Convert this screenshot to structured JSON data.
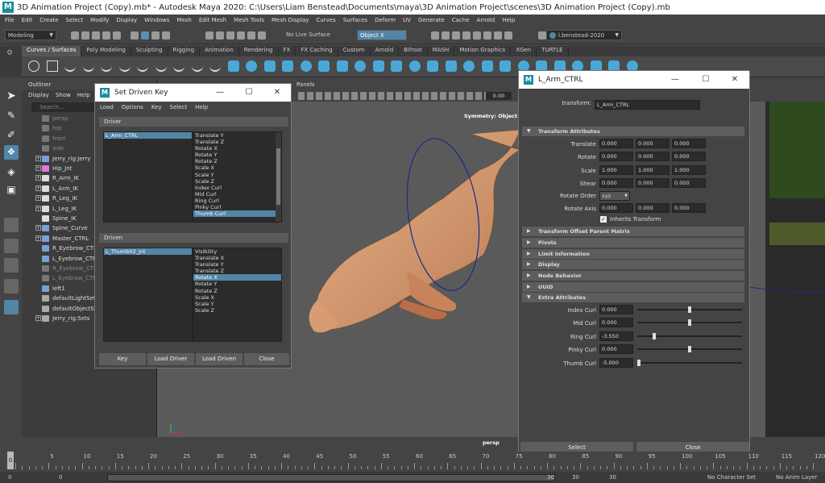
{
  "window": {
    "title": "3D Animation Project (Copy).mb* - Autodesk Maya 2020: C:\\Users\\Liam Benstead\\Documents\\maya\\3D Animation Project\\scenes\\3D Animation Project (Copy).mb",
    "logo": "M"
  },
  "menubar": [
    "File",
    "Edit",
    "Create",
    "Select",
    "Modify",
    "Display",
    "Windows",
    "Mesh",
    "Edit Mesh",
    "Mesh Tools",
    "Mesh Display",
    "Curves",
    "Surfaces",
    "Deform",
    "UV",
    "Generate",
    "Cache",
    "Arnold",
    "Help"
  ],
  "statusline": {
    "mode": "Modeling",
    "live_surface": "No Live Surface",
    "symmetry": "Object X",
    "user": "l.benstead-2020"
  },
  "shelf": {
    "tabs": [
      "Curves / Surfaces",
      "Poly Modeling",
      "Sculpting",
      "Rigging",
      "Animation",
      "Rendering",
      "FX",
      "FX Caching",
      "Custom",
      "Arnold",
      "Bifrost",
      "MASH",
      "Motion Graphics",
      "XGen",
      "TURTLE"
    ],
    "active": "Curves / Surfaces"
  },
  "outliner": {
    "title": "Outliner",
    "menu": [
      "Display",
      "Show",
      "Help"
    ],
    "search_placeholder": "Search...",
    "items": [
      {
        "label": "persp",
        "dim": true
      },
      {
        "label": "top",
        "dim": true
      },
      {
        "label": "front",
        "dim": true
      },
      {
        "label": "side",
        "dim": true
      },
      {
        "label": "Jerry_rig:Jerry",
        "dim": false
      },
      {
        "label": "Hip_Jnt",
        "dim": false
      },
      {
        "label": "R_Arm_IK",
        "dim": false
      },
      {
        "label": "L_Arm_IK",
        "dim": false
      },
      {
        "label": "R_Leg_IK",
        "dim": false
      },
      {
        "label": "L_Leg_IK",
        "dim": false
      },
      {
        "label": "Spine_IK",
        "dim": false
      },
      {
        "label": "Spine_Curve",
        "dim": false
      },
      {
        "label": "Master_CTRL",
        "dim": false
      },
      {
        "label": "R_Eyebrow_CTRL",
        "dim": false
      },
      {
        "label": "L_Eyebrow_CTRL",
        "dim": false
      },
      {
        "label": "R_Eyebrow_CTRL",
        "dim": true
      },
      {
        "label": "L_Eyebrow_CTRL",
        "dim": true
      },
      {
        "label": "left1",
        "dim": false
      },
      {
        "label": "defaultLightSet",
        "dim": false
      },
      {
        "label": "defaultObjectSet",
        "dim": false
      },
      {
        "label": "Jerry_rig:Sets",
        "dim": false
      }
    ]
  },
  "viewport": {
    "menu": [
      "Panels"
    ],
    "symmetry_label": "Symmetry: Object X",
    "camera_label": "persp",
    "exposure": "0.00"
  },
  "sdk": {
    "title": "Set Driven Key",
    "menu": [
      "Load",
      "Options",
      "Key",
      "Select",
      "Help"
    ],
    "driver_label": "Driver",
    "driven_label": "Driven",
    "driver_object": "L_Arm_CTRL",
    "driver_attrs": [
      "Translate Y",
      "Translate Z",
      "Rotate X",
      "Rotate Y",
      "Rotate Z",
      "Scale X",
      "Scale Y",
      "Scale Z",
      "Index Curl",
      "Mid Curl",
      "Ring Curl",
      "Pinky Curl",
      "Thumb Curl"
    ],
    "driver_selected": "Thumb Curl",
    "driven_object": "L_Thumb02_jnt",
    "driven_attrs": [
      "Visibility",
      "Translate X",
      "Translate Y",
      "Translate Z",
      "Rotate X",
      "Rotate Y",
      "Rotate Z",
      "Scale X",
      "Scale Y",
      "Scale Z"
    ],
    "driven_selected": "Rotate X",
    "buttons": [
      "Key",
      "Load Driver",
      "Load Driven",
      "Close"
    ]
  },
  "ae": {
    "title": "L_Arm_CTRL",
    "transform_label": "transform:",
    "transform_name": "L_Arm_CTRL",
    "sections": {
      "transform_attributes": "Transform Attributes",
      "collapsed": [
        "Transform Offset Parent Matrix",
        "Pivots",
        "Limit Information",
        "Display",
        "Node Behavior",
        "UUID"
      ],
      "extra": "Extra Attributes"
    },
    "rows": [
      {
        "label": "Translate",
        "values": [
          "0.000",
          "0.000",
          "0.000"
        ]
      },
      {
        "label": "Rotate",
        "values": [
          "0.000",
          "0.000",
          "0.000"
        ]
      },
      {
        "label": "Scale",
        "values": [
          "1.000",
          "1.000",
          "1.000"
        ]
      },
      {
        "label": "Shear",
        "values": [
          "0.000",
          "0.000",
          "0.000"
        ]
      }
    ],
    "rotate_order_label": "Rotate Order",
    "rotate_order": "xyz",
    "rotate_axis_label": "Rotate Axis",
    "rotate_axis": [
      "0.000",
      "0.000",
      "0.000"
    ],
    "inherits_transform": "Inherits Transform",
    "extra_attrs": [
      {
        "label": "Index Curl",
        "value": "0.000",
        "slider": 0.5
      },
      {
        "label": "Mid Curl",
        "value": "0.000",
        "slider": 0.5
      },
      {
        "label": "Ring Curl",
        "value": "-3.550",
        "slider": 0.15
      },
      {
        "label": "Pinky Curl",
        "value": "0.000",
        "slider": 0.5
      },
      {
        "label": "Thumb Curl",
        "value": "-5.000",
        "slider": 0.0
      }
    ],
    "buttons": [
      "Select",
      "Close"
    ]
  },
  "timeline": {
    "ticks": [
      "0",
      "5",
      "10",
      "15",
      "20",
      "25",
      "30",
      "35",
      "40",
      "45",
      "50",
      "55",
      "60",
      "65",
      "70",
      "75",
      "80",
      "85",
      "90",
      "95",
      "100",
      "105",
      "110",
      "115",
      "120"
    ],
    "current": "0"
  },
  "bottombar": {
    "start": "0",
    "start2": "0",
    "range_end": "30",
    "end": "30",
    "end2": "30",
    "character_set": "No Character Set",
    "anim_layer": "No Anim Layer"
  }
}
